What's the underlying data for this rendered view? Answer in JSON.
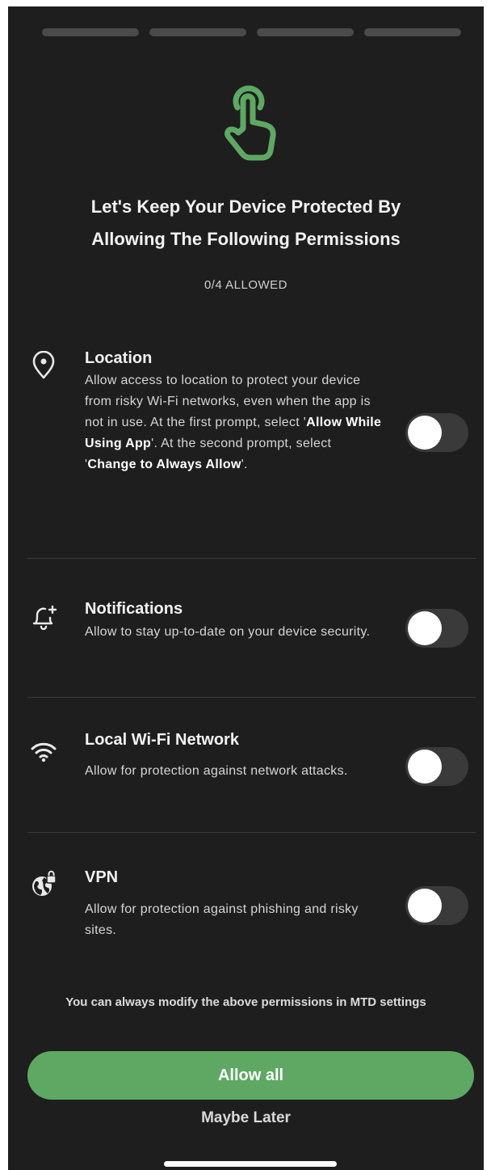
{
  "progress": {
    "steps": 4
  },
  "hero": {
    "icon": "hand-pointer-icon",
    "color": "#5ea863"
  },
  "title": {
    "line1": "Let's Keep Your Device Protected By",
    "line2": "Allowing The Following Permissions"
  },
  "allowed_count": "0/4 ALLOWED",
  "permissions": [
    {
      "icon": "location-pin-icon",
      "name": "Location",
      "desc_parts": [
        "Allow access to location to protect your device from risky Wi-Fi networks, even when the app is not in use. At the first prompt, select '",
        "Allow While Using App",
        "'. At the second prompt, select '",
        "Change to Always Allow",
        "'."
      ],
      "enabled": false
    },
    {
      "icon": "bell-plus-icon",
      "name": "Notifications",
      "desc": "Allow to stay up-to-date on your device security.",
      "enabled": false
    },
    {
      "icon": "wifi-icon",
      "name": "Local Wi-Fi Network",
      "desc": "Allow for protection against network attacks.",
      "enabled": false
    },
    {
      "icon": "globe-lock-icon",
      "name": "VPN",
      "desc": "Allow for protection against phishing and risky sites.",
      "enabled": false
    }
  ],
  "footnote": "You can always modify the above permissions in MTD settings",
  "buttons": {
    "allow_all": "Allow all",
    "maybe_later": "Maybe Later"
  },
  "colors": {
    "background": "#1e1e1e",
    "accent": "#5ea863",
    "toggle_off": "#3a3a3a"
  }
}
